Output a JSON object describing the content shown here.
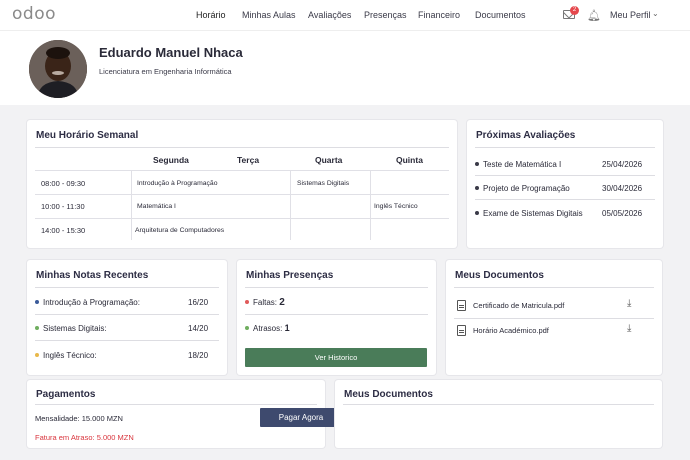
{
  "nav": {
    "logo": "odoo",
    "items": [
      "Horário",
      "Minhas Aulas",
      "Avaliações",
      "Presenças",
      "Financeiro",
      "Documentos"
    ],
    "notification_count": "2",
    "profile_label": "Meu Perfil"
  },
  "profile": {
    "name": "Eduardo Manuel Nhaca",
    "course": "Licenciatura em Engenharia Informática"
  },
  "schedule": {
    "title": "Meu Horário Semanal",
    "days": [
      "Segunda",
      "Terça",
      "Quarta",
      "Quinta"
    ],
    "rows": [
      {
        "time": "08:00 - 09:30",
        "cells": [
          "Introdução à Programação",
          "",
          "Sistemas Digitais",
          ""
        ]
      },
      {
        "time": "10:00 - 11:30",
        "cells": [
          "Matemática I",
          "",
          "",
          "Inglês Técnico"
        ]
      },
      {
        "time": "14:00 - 15:30",
        "cells": [
          "Arquitetura de Computadores",
          "",
          "",
          ""
        ]
      }
    ]
  },
  "evaluations": {
    "title": "Próximas Avaliações",
    "items": [
      {
        "name": "Teste de Matemática I",
        "date": "25/04/2026"
      },
      {
        "name": "Projeto de Programação",
        "date": "30/04/2026"
      },
      {
        "name": "Exame de Sistemas Digitais",
        "date": "05/05/2026"
      }
    ]
  },
  "grades": {
    "title": "Minhas Notas Recentes",
    "items": [
      {
        "subject": "Introdução à Programação:",
        "grade": "16/20",
        "color": "#3b5b9a"
      },
      {
        "subject": "Sistemas Digitais:",
        "grade": "14/20",
        "color": "#6fae5f"
      },
      {
        "subject": "Inglês Técnico:",
        "grade": "18/20",
        "color": "#e8b84a"
      }
    ]
  },
  "attendance": {
    "title": "Minhas Presenças",
    "absences_label": "Faltas:",
    "absences_value": "2",
    "absences_color": "#e05a5a",
    "lates_label": "Atrasos:",
    "lates_value": "1",
    "lates_color": "#6fae5f",
    "button": "Ver Historico"
  },
  "documents": {
    "title": "Meus Documentos",
    "items": [
      "Certificado de Matricula.pdf",
      "Horário Académico.pdf"
    ]
  },
  "payments": {
    "title": "Pagamentos",
    "monthly": "Mensalidade: 15.000 MZN",
    "overdue": "Fatura em Atraso: 5.000 MZN",
    "overdue_color": "#d9363e",
    "button": "Pagar Agora"
  },
  "documents2": {
    "title": "Meus Documentos"
  }
}
